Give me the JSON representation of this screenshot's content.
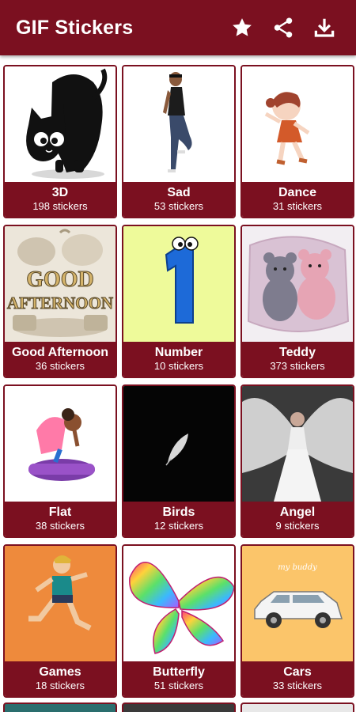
{
  "app": {
    "title": "GIF Stickers"
  },
  "toolbar": {
    "favorite_icon": "star-icon",
    "share_icon": "share-icon",
    "download_icon": "download-icon"
  },
  "colors": {
    "primary": "#7b1020",
    "text_on_primary": "#ffffff"
  },
  "categories": [
    {
      "name": "3D",
      "count": "198 stickers"
    },
    {
      "name": "Sad",
      "count": "53 stickers"
    },
    {
      "name": "Dance",
      "count": "31 stickers"
    },
    {
      "name": "Good Afternoon",
      "count": "36 stickers"
    },
    {
      "name": "Number",
      "count": "10 stickers"
    },
    {
      "name": "Teddy",
      "count": "373 stickers"
    },
    {
      "name": "Flat",
      "count": "38 stickers"
    },
    {
      "name": "Birds",
      "count": "12 stickers"
    },
    {
      "name": "Angel",
      "count": "9 stickers"
    },
    {
      "name": "Games",
      "count": "18 stickers"
    },
    {
      "name": "Butterfly",
      "count": "51 stickers"
    },
    {
      "name": "Cars",
      "count": "33 stickers"
    }
  ],
  "thumbnail_text": {
    "good_afternoon_line1": "GOOD",
    "good_afternoon_line2": "AFTERNOON",
    "number_digit": "1",
    "cars_script": "my buddy"
  }
}
